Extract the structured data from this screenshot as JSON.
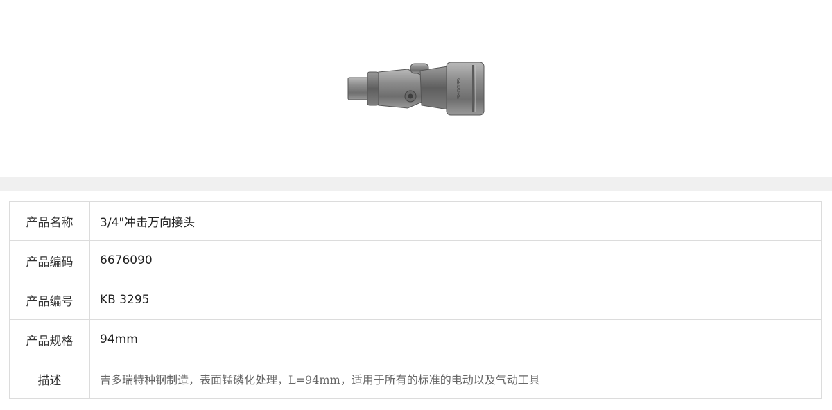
{
  "product_image": {
    "icon": "universal-joint-photo",
    "brand_text": "GEDORE"
  },
  "spec_rows": [
    {
      "label": "产品名称",
      "value": "3/4\"冲击万向接头"
    },
    {
      "label": "产品编码",
      "value": "6676090"
    },
    {
      "label": "产品编号",
      "value": "KB 3295"
    },
    {
      "label": "产品规格",
      "value": "94mm"
    },
    {
      "label": "描述",
      "value": "吉多瑞特种钢制造，表面锰磷化处理，L=94mm，适用于所有的标准的电动以及气动工具"
    }
  ]
}
